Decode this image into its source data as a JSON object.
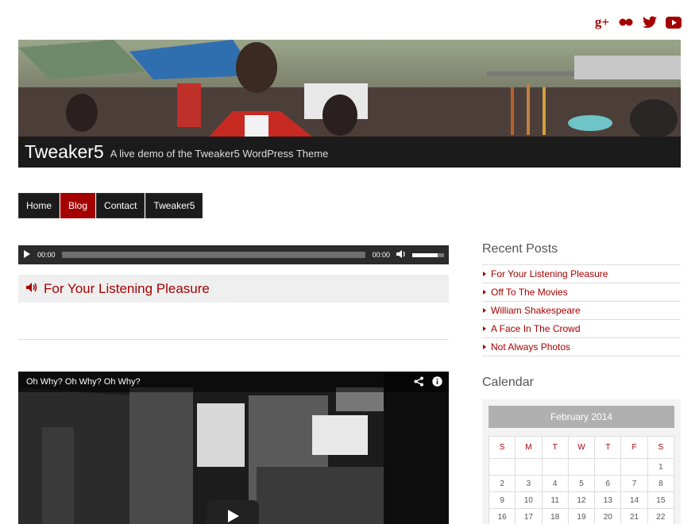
{
  "social": {
    "google_plus": "g+",
    "flickr": "flickr-icon",
    "twitter": "twitter-icon",
    "youtube": "youtube-icon",
    "accent": "#a50000"
  },
  "header": {
    "site_title": "Tweaker5",
    "site_description": "A live demo of the Tweaker5 WordPress Theme"
  },
  "nav": {
    "items": [
      {
        "label": "Home"
      },
      {
        "label": "Blog"
      },
      {
        "label": "Contact"
      },
      {
        "label": "Tweaker5"
      }
    ]
  },
  "audio_player": {
    "current_time": "00:00",
    "duration": "00:00",
    "volume_level": 0.8
  },
  "post": {
    "title": "For Your Listening Pleasure"
  },
  "video": {
    "title": "Oh Why? Oh Why? Oh Why?"
  },
  "sidebar": {
    "recent_posts_title": "Recent Posts",
    "recent_posts": [
      "For Your Listening Pleasure",
      "Off To The Movies",
      "William Shakespeare",
      "A Face In The Crowd",
      "Not Always Photos"
    ],
    "calendar_title": "Calendar",
    "calendar": {
      "month": "February 2014",
      "weekdays": [
        "S",
        "M",
        "T",
        "W",
        "T",
        "F",
        "S"
      ],
      "weeks": [
        [
          "",
          "",
          "",
          "",
          "",
          "",
          "1"
        ],
        [
          "2",
          "3",
          "4",
          "5",
          "6",
          "7",
          "8"
        ],
        [
          "9",
          "10",
          "11",
          "12",
          "13",
          "14",
          "15"
        ],
        [
          "16",
          "17",
          "18",
          "19",
          "20",
          "21",
          "22"
        ]
      ]
    }
  }
}
